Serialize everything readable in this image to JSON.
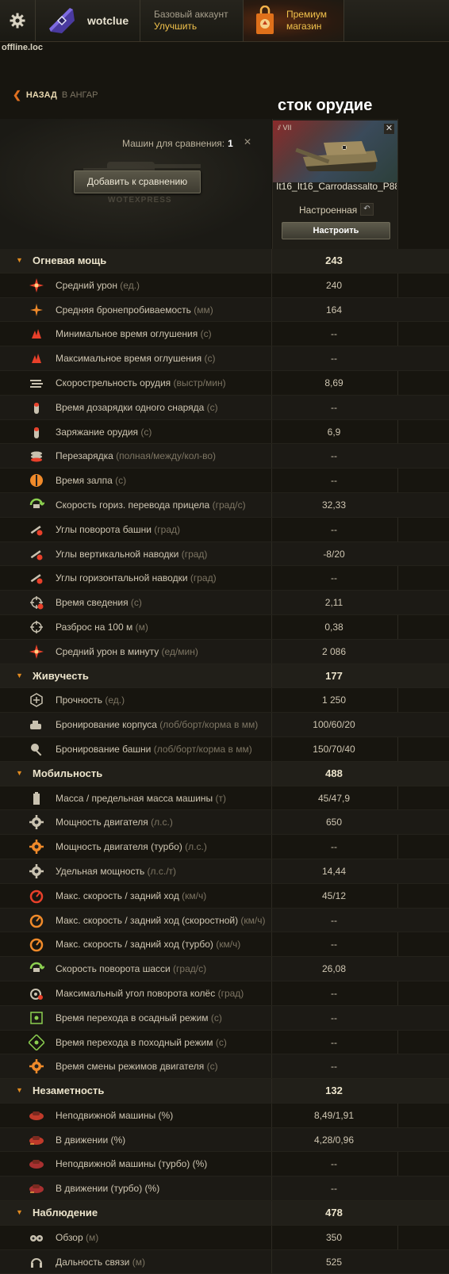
{
  "topbar": {
    "settings_icon": "gear-icon",
    "username": "wotclue",
    "account_type": "Базовый аккаунт",
    "upgrade_label": "Улучшить",
    "premium_line1": "Премиум",
    "premium_line2": "магазин",
    "host": "offline.loc"
  },
  "breadcrumb": {
    "back_label": "НАЗАД",
    "to_hangar": "В АНГАР"
  },
  "overlay_title": "сток орудие",
  "compare": {
    "count_label": "Машин для сравнения:",
    "count_value": "1",
    "add_button": "Добавить к сравнению",
    "ghost_label": "WOTEXPRESS"
  },
  "vehicle": {
    "tier": "VII",
    "name": "It16_It16_Carrodassalto_P88",
    "status": "Настроенная",
    "configure_button": "Настроить"
  },
  "accent_colors": {
    "section_arrow": "#e08a20",
    "upgrade": "#f2c24c"
  },
  "sections": [
    {
      "title": "Огневая мощь",
      "value": "243",
      "rows": [
        {
          "label": "Средний урон",
          "unit": "(ед.)",
          "value": "240",
          "icon": "damage-icon"
        },
        {
          "label": "Средняя бронепробиваемость",
          "unit": "(мм)",
          "value": "164",
          "icon": "penetration-icon"
        },
        {
          "label": "Минимальное время оглушения",
          "unit": "(с)",
          "value": "--",
          "icon": "stun-min-icon"
        },
        {
          "label": "Максимальное время оглушения",
          "unit": "(с)",
          "value": "--",
          "icon": "stun-max-icon"
        },
        {
          "label": "Скорострельность орудия",
          "unit": "(выстр/мин)",
          "value": "8,69",
          "icon": "rate-of-fire-icon"
        },
        {
          "label": "Время дозарядки одного снаряда",
          "unit": "(с)",
          "value": "--",
          "icon": "shell-reload-icon"
        },
        {
          "label": "Заряжание орудия",
          "unit": "(с)",
          "value": "6,9",
          "icon": "loading-icon"
        },
        {
          "label": "Перезарядка",
          "unit": "(полная/между/кол-во)",
          "value": "--",
          "icon": "magazine-icon"
        },
        {
          "label": "Время залпа",
          "unit": "(с)",
          "value": "--",
          "icon": "salvo-icon"
        },
        {
          "label": "Скорость гориз. перевода прицела",
          "unit": "(град/с)",
          "value": "32,33",
          "icon": "traverse-icon"
        },
        {
          "label": "Углы поворота башни",
          "unit": "(град)",
          "value": "--",
          "icon": "turret-angle-icon"
        },
        {
          "label": "Углы вертикальной наводки",
          "unit": "(град)",
          "value": "-8/20",
          "icon": "elevation-icon"
        },
        {
          "label": "Углы горизонтальной наводки",
          "unit": "(град)",
          "value": "--",
          "icon": "horizontal-aim-icon"
        },
        {
          "label": "Время сведения",
          "unit": "(с)",
          "value": "2,11",
          "icon": "aim-time-icon"
        },
        {
          "label": "Разброс на 100 м",
          "unit": "(м)",
          "value": "0,38",
          "icon": "dispersion-icon"
        },
        {
          "label": "Средний урон в минуту",
          "unit": "(ед/мин)",
          "value": "2 086",
          "icon": "dpm-icon"
        }
      ]
    },
    {
      "title": "Живучесть",
      "value": "177",
      "rows": [
        {
          "label": "Прочность",
          "unit": "(ед.)",
          "value": "1 250",
          "icon": "hitpoints-icon"
        },
        {
          "label": "Бронирование корпуса",
          "unit": "(лоб/борт/корма в мм)",
          "value": "100/60/20",
          "icon": "hull-armor-icon"
        },
        {
          "label": "Бронирование башни",
          "unit": "(лоб/борт/корма в мм)",
          "value": "150/70/40",
          "icon": "turret-armor-icon"
        }
      ]
    },
    {
      "title": "Мобильность",
      "value": "488",
      "rows": [
        {
          "label": "Масса / предельная масса машины",
          "unit": "(т)",
          "value": "45/47,9",
          "icon": "weight-icon"
        },
        {
          "label": "Мощность двигателя",
          "unit": "(л.с.)",
          "value": "650",
          "icon": "engine-icon"
        },
        {
          "label": "Мощность двигателя (турбо)",
          "unit": "(л.с.)",
          "value": "--",
          "icon": "engine-turbo-icon"
        },
        {
          "label": "Удельная мощность",
          "unit": "(л.с./т)",
          "value": "14,44",
          "icon": "power-ratio-icon"
        },
        {
          "label": "Макс. скорость / задний ход",
          "unit": "(км/ч)",
          "value": "45/12",
          "icon": "speed-icon"
        },
        {
          "label": "Макс. скорость / задний ход (скоростной)",
          "unit": "(км/ч)",
          "value": "--",
          "icon": "speed-fast-icon"
        },
        {
          "label": "Макс. скорость / задний ход (турбо)",
          "unit": "(км/ч)",
          "value": "--",
          "icon": "speed-turbo-icon"
        },
        {
          "label": "Скорость поворота шасси",
          "unit": "(град/с)",
          "value": "26,08",
          "icon": "hull-traverse-icon"
        },
        {
          "label": "Максимальный угол поворота колёс",
          "unit": "(град)",
          "value": "--",
          "icon": "wheel-angle-icon"
        },
        {
          "label": "Время перехода в осадный режим",
          "unit": "(с)",
          "value": "--",
          "icon": "siege-mode-icon"
        },
        {
          "label": "Время перехода в походный режим",
          "unit": "(с)",
          "value": "--",
          "icon": "travel-mode-icon"
        },
        {
          "label": "Время смены режимов двигателя",
          "unit": "(с)",
          "value": "--",
          "icon": "engine-mode-icon"
        }
      ]
    },
    {
      "title": "Незаметность",
      "value": "132",
      "rows": [
        {
          "label": "Неподвижной машины (%)",
          "unit": "",
          "value": "8,49/1,91",
          "icon": "camo-stationary-icon"
        },
        {
          "label": "В движении (%)",
          "unit": "",
          "value": "4,28/0,96",
          "icon": "camo-moving-icon"
        },
        {
          "label": "Неподвижной машины (турбо) (%)",
          "unit": "",
          "value": "--",
          "icon": "camo-stationary-turbo-icon"
        },
        {
          "label": "В движении (турбо) (%)",
          "unit": "",
          "value": "--",
          "icon": "camo-moving-turbo-icon"
        }
      ]
    },
    {
      "title": "Наблюдение",
      "value": "478",
      "rows": [
        {
          "label": "Обзор",
          "unit": "(м)",
          "value": "350",
          "icon": "view-range-icon"
        },
        {
          "label": "Дальность связи",
          "unit": "(м)",
          "value": "525",
          "icon": "radio-range-icon"
        }
      ]
    }
  ]
}
